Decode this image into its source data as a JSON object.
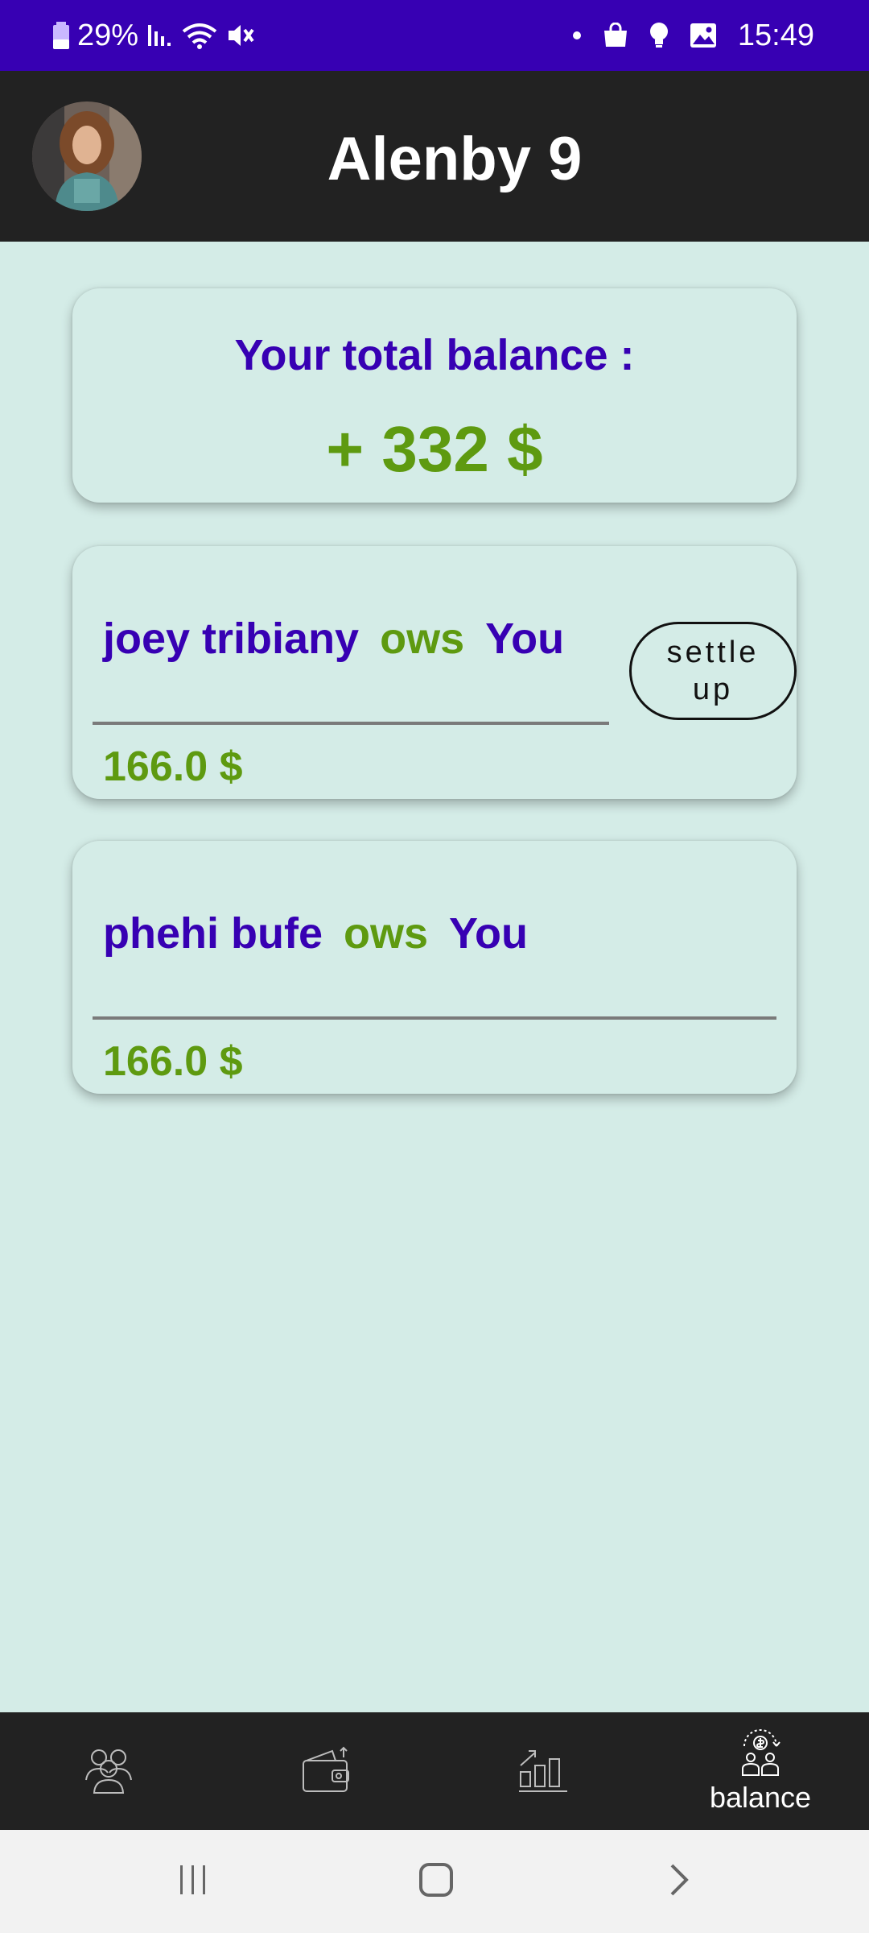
{
  "status_bar": {
    "battery": "29%",
    "time": "15:49"
  },
  "header": {
    "title": "Alenby 9"
  },
  "balance_card": {
    "label": "Your total balance :",
    "amount": "+ 332 $"
  },
  "debts": [
    {
      "name": "joey tribiany",
      "verb": "ows",
      "target": "You",
      "amount": "166.0 $",
      "settle_label": "settle up"
    },
    {
      "name": "phehi bufe",
      "verb": "ows",
      "target": "You",
      "amount": "166.0 $"
    }
  ],
  "bottom_nav": {
    "items": [
      {
        "icon": "group-icon"
      },
      {
        "icon": "wallet-icon"
      },
      {
        "icon": "chart-icon"
      },
      {
        "icon": "balance-icon",
        "label": "balance",
        "selected": true
      }
    ]
  },
  "colors": {
    "status_bar": "#3700b3",
    "app_bar": "#222222",
    "background": "#d4ece7",
    "primary_text": "#3700b3",
    "positive": "#5e9a10"
  }
}
